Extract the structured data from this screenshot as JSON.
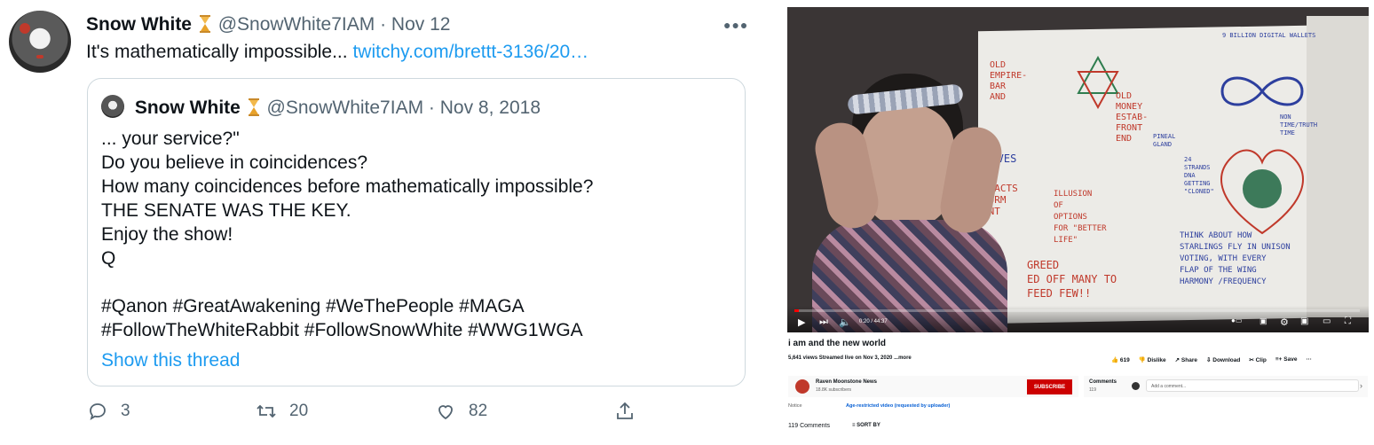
{
  "tweet": {
    "author_name": "Snow White",
    "author_handle": "@SnowWhite7IAM",
    "date": "· Nov 12",
    "more_icon": "more-icon",
    "text": "It's mathematically impossible... ",
    "link_text": "twitchy.com/brettt-3136/20…",
    "quote": {
      "author_name": "Snow White",
      "author_handle": "@SnowWhite7IAM",
      "date": "· Nov 8, 2018",
      "lines": [
        "... your service?\"",
        "Do you believe in coincidences?",
        "How many coincidences before mathematically impossible?",
        "THE SENATE WAS THE KEY.",
        "Enjoy the show!",
        "Q",
        "",
        "#Qanon #GreatAwakening #WeThePeople #MAGA",
        "#FollowTheWhiteRabbit #FollowSnowWhite #WWG1WGA"
      ],
      "show_thread": "Show this thread"
    },
    "actions": {
      "reply_count": "3",
      "retweet_count": "20",
      "like_count": "82"
    },
    "colors": {
      "link": "#1d9bf0",
      "muted": "#536471"
    }
  },
  "youtube": {
    "player": {
      "time": "0:20 / 44:37",
      "progress": 0.0075
    },
    "board_text": {
      "top_left": "OLD\nEMPIRE-\nBAR\nAND",
      "money": "OLD\nMONEY\nESTAB-\nFRONT\nEND",
      "slaves": "SLAVES",
      "tracts": "TRACTS\nFORM\nENT",
      "illusion": "ILLUSION\nOF\nOPTIONS\nFOR \"BETTER\nLIFE\"",
      "greed": "GREED\nED OFF MANY TO\nFEED FEW!!",
      "billion": "9 BILLION DIGITAL WALLETS",
      "time": "NON\nTIME/TRUTH\nTIME",
      "pineal": "PINEAL\nGLAND",
      "strands": "24\nSTRANDS\nDNA\nGETTING\n\"CLONED\"",
      "think": "THINK ABOUT HOW\nSTARLINGS FLY IN UNISON\nVOTING, WITH EVERY\nFLAP OF THE WING\nHARMONY /FREQUENCY"
    },
    "title": "i am and the new world",
    "meta": "5,641 views  Streamed live on Nov 3, 2020  ...more",
    "actions": {
      "likes": "619",
      "dislike": "Dislike",
      "share": "Share",
      "download": "Download",
      "clip": "Clip",
      "save": "Save",
      "more": "···"
    },
    "channel": {
      "name": "Raven Moonstone News",
      "subscribers": "18.8K subscribers",
      "subscribe_label": "SUBSCRIBE"
    },
    "comments_panel": {
      "label": "Comments",
      "count": "119",
      "placeholder": "Add a comment..."
    },
    "notice": {
      "label": "Notice",
      "value": "Age-restricted video (requested by uploader)"
    },
    "comments_count": "119 Comments",
    "sort_by": "SORT BY",
    "colors": {
      "subscribe": "#cc0000",
      "progress": "#ff0000",
      "notice_link": "#065fd4"
    }
  }
}
